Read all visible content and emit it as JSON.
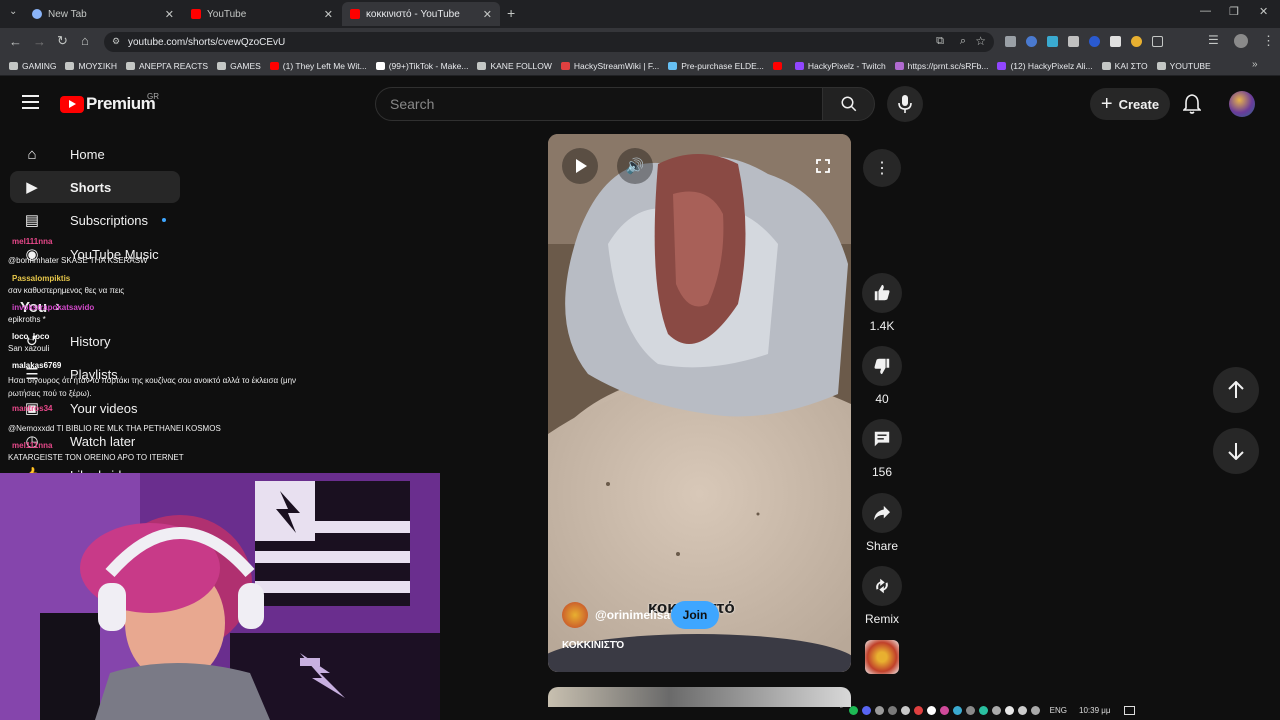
{
  "browser": {
    "tabs": [
      {
        "title": "New Tab",
        "active": false
      },
      {
        "title": "YouTube",
        "active": false
      },
      {
        "title": "κοκκινιστό - YouTube",
        "active": true
      }
    ],
    "new_tab_symbol": "+",
    "url": "youtube.com/shorts/cvewQzoCEvU",
    "bookmarks": [
      {
        "label": "GAMING",
        "icon": "folder-icon",
        "color": "#c4c7c5"
      },
      {
        "label": "ΜΟΥΣΙΚΗ",
        "icon": "folder-icon",
        "color": "#c4c7c5"
      },
      {
        "label": "ΑΝΕΡΓΑ REACTS",
        "icon": "folder-icon",
        "color": "#c4c7c5"
      },
      {
        "label": "GAMES",
        "icon": "folder-icon",
        "color": "#c4c7c5"
      },
      {
        "label": "(1) They Left Me Wit...",
        "icon": "youtube-icon",
        "color": "#ff0000"
      },
      {
        "label": "(99+)TikTok - Make...",
        "icon": "tiktok-icon",
        "color": "#ffffff"
      },
      {
        "label": "KANE FOLLOW",
        "icon": "star-icon",
        "color": "#c4c7c5"
      },
      {
        "label": "HackyStreamWiki | F...",
        "icon": "wiki-icon",
        "color": "#e04040"
      },
      {
        "label": "Pre-purchase ELDE...",
        "icon": "steam-icon",
        "color": "#66c0f4"
      },
      {
        "label": "",
        "icon": "youtube-icon",
        "color": "#ff0000"
      },
      {
        "label": "HackyPixelz - Twitch",
        "icon": "twitch-icon",
        "color": "#9146ff"
      },
      {
        "label": "https://prnt.sc/sRFb...",
        "icon": "lightshot-icon",
        "color": "#b06ad0"
      },
      {
        "label": "(12) HackyPixelz Ali...",
        "icon": "twitch-icon",
        "color": "#9146ff"
      },
      {
        "label": "ΚΑΙ ΣΤΟ",
        "icon": "star-icon",
        "color": "#c4c7c5"
      },
      {
        "label": "YOUTUBE",
        "icon": "star-icon",
        "color": "#c4c7c5"
      }
    ]
  },
  "youtube": {
    "logo_text": "Premium",
    "country_code": "GR",
    "search_placeholder": "Search",
    "create_label": "Create",
    "sidebar": [
      {
        "label": "Home",
        "icon": "home-icon",
        "active": false
      },
      {
        "label": "Shorts",
        "icon": "shorts-icon",
        "active": true
      },
      {
        "label": "Subscriptions",
        "icon": "subscriptions-icon",
        "active": false
      },
      {
        "label": "YouTube Music",
        "icon": "youtube-music-icon",
        "active": false
      },
      {
        "label": "You",
        "icon": "chevron-right-icon",
        "active": false
      },
      {
        "label": "History",
        "icon": "history-icon",
        "active": false
      },
      {
        "label": "Playlists",
        "icon": "playlists-icon",
        "active": false
      },
      {
        "label": "Your videos",
        "icon": "your-videos-icon",
        "active": false
      },
      {
        "label": "Watch later",
        "icon": "watch-later-icon",
        "active": false
      },
      {
        "label": "Liked videos",
        "icon": "liked-videos-icon",
        "active": false
      }
    ],
    "short": {
      "channel": "@orinimelisa",
      "join_label": "Join",
      "caption_overlay": "κοκκινιστό",
      "title": "ΚΟΚΚΙΝΙΣΤΌ",
      "likes": "1.4K",
      "dislikes": "40",
      "comments": "156",
      "share_label": "Share",
      "remix_label": "Remix"
    }
  },
  "stream_chat": [
    {
      "user": "mel111nna",
      "color": "#e8488a",
      "message": "@bonnmhater SKASE THA KSERASW"
    },
    {
      "user": "Passalompiktis",
      "color": "#e8c84a",
      "message": "σαν καθυστερημενος θες να πεις"
    },
    {
      "user": "invokstrapokatsavido",
      "color": "#d048c8",
      "message": "epikroths *"
    },
    {
      "user": "loco_loco",
      "color": "#ffffff",
      "message": "San xazouli"
    },
    {
      "user": "malakas6769",
      "color": "#ffffff",
      "message": "Ησαι σιγουρος ότι ήταν το πορτάκι της κουζίνας σου ανοικτό αλλά το έκλεισα (μην ρωτήσεις πού το ξέρω)."
    },
    {
      "user": "mantros34",
      "color": "#e8488a",
      "message": "@Nemoxxdd TI BIBLIO RE MLK THA PETHANEI KOSMOS"
    },
    {
      "user": "mel111nna",
      "color": "#e8488a",
      "message": "KATARGEISTE TON OREINO APO TO ITERNET"
    }
  ],
  "taskbar": {
    "language": "ENG",
    "time": "10:39 μμ"
  }
}
